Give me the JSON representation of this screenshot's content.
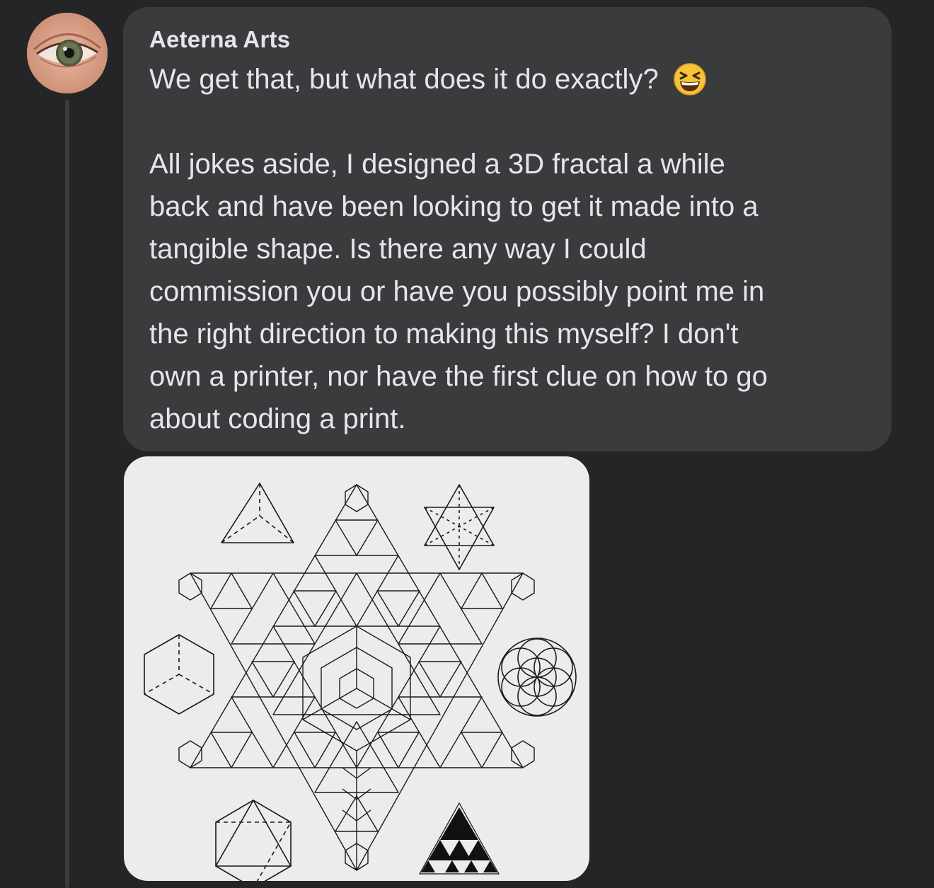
{
  "comment": {
    "author": "Aeterna Arts",
    "emoji_icon": "grinning-squinting-face-icon",
    "lines": [
      "We get that, but what does it do exactly?",
      "",
      "All jokes aside, I designed a 3D fractal a while",
      "back and have been looking to get it made into a",
      "tangible shape. Is there any way I could",
      "commission you or have you possibly point me in",
      "the right direction to making this myself? I don't",
      "own a printer, nor have the first clue on how to go",
      "about coding a print."
    ]
  },
  "avatar": {
    "icon": "eye-icon"
  },
  "colors": {
    "background": "#242526",
    "bubble": "#3a3b3c",
    "text": "#e4e6eb",
    "attachment_paper": "#ececea"
  }
}
